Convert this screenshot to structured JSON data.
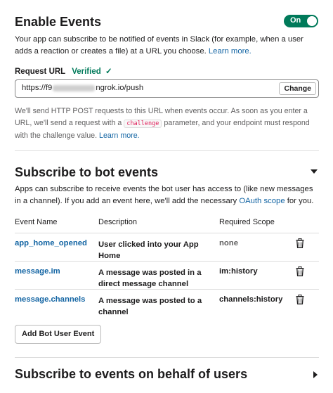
{
  "enable_events": {
    "title": "Enable Events",
    "toggle_label": "On",
    "description": "Your app can subscribe to be notified of events in Slack (for example, when a user adds a reaction or creates a file) at a URL you choose.",
    "learn_more": "Learn more."
  },
  "request_url": {
    "label": "Request URL",
    "verified": "Verified",
    "verified_icon": "✓",
    "value_prefix": "https://f9",
    "value_suffix": "ngrok.io/push",
    "change_button": "Change",
    "help_part1": "We'll send HTTP POST requests to this URL when events occur. As soon as you enter a URL, we'll send a request with a",
    "help_code": "challenge",
    "help_part2": "parameter, and your endpoint must respond with the challenge value.",
    "help_learn_more": "Learn more."
  },
  "bot_events": {
    "title": "Subscribe to bot events",
    "description_part1": "Apps can subscribe to receive events the bot user has access to (like new messages in a channel). If you add an event here, we'll add the necessary",
    "oauth_link": "OAuth scope",
    "description_part2": "for you.",
    "columns": [
      "Event Name",
      "Description",
      "Required Scope"
    ],
    "rows": [
      {
        "name": "app_home_opened",
        "description": "User clicked into your App Home",
        "scope": "none"
      },
      {
        "name": "message.im",
        "description": "A message was posted in a direct message channel",
        "scope": "im:history"
      },
      {
        "name": "message.channels",
        "description": "A message was posted to a channel",
        "scope": "channels:history"
      }
    ],
    "add_button": "Add Bot User Event"
  },
  "user_events": {
    "title": "Subscribe to events on behalf of users"
  },
  "colors": {
    "accent_green": "#007a5a",
    "link_blue": "#1264a3",
    "code_red": "#e01e5a"
  }
}
